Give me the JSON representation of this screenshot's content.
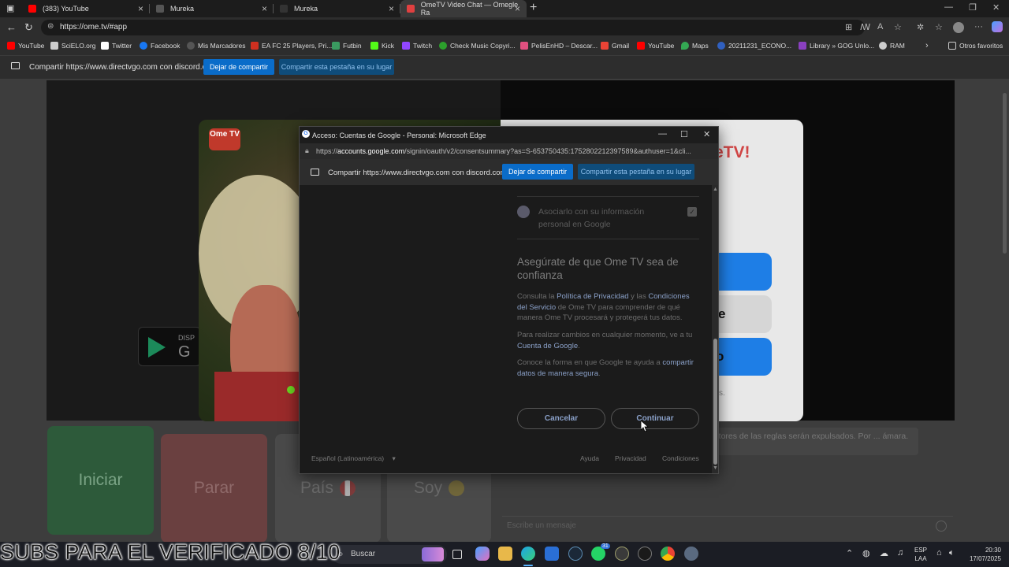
{
  "tabs": [
    {
      "title": "(383) YouTube",
      "favicon_color": "#ff0000"
    },
    {
      "title": "Mureka",
      "favicon_color": "#444444"
    },
    {
      "title": "Mureka",
      "favicon_color": "#222222"
    },
    {
      "title": "OmeTV Video Chat — Omegle Ra",
      "favicon_color": "#e04040"
    }
  ],
  "address": {
    "url": "https://ome.tv/#app"
  },
  "bookmarks": [
    {
      "label": "YouTube",
      "color": "#ff0000"
    },
    {
      "label": "SciELO.org",
      "color": "#cccccc"
    },
    {
      "label": "Twitter",
      "color": "#ffffff"
    },
    {
      "label": "Facebook",
      "color": "#1877f2"
    },
    {
      "label": "Mis Marcadores",
      "color": "#333333"
    },
    {
      "label": "EA FC 25 Players, Pri...",
      "color": "#d03020"
    },
    {
      "label": "Futbin",
      "color": "#3a9a60"
    },
    {
      "label": "Kick",
      "color": "#53fc18"
    },
    {
      "label": "Twitch",
      "color": "#9146ff"
    },
    {
      "label": "Check Music Copyri...",
      "color": "#2ca02c"
    },
    {
      "label": "PelisEnHD – Descar...",
      "color": "#e05080"
    },
    {
      "label": "Gmail",
      "color": "#ea4335"
    },
    {
      "label": "YouTube",
      "color": "#ff0000"
    },
    {
      "label": "Maps",
      "color": "#34a853"
    },
    {
      "label": "20211231_ECONO...",
      "color": "#3060c0"
    },
    {
      "label": "Library » GOG Unlo...",
      "color": "#8a40c0"
    },
    {
      "label": "RAM",
      "color": "#cccccc"
    }
  ],
  "other_favorites": "Otros favoritos",
  "share_bar": {
    "text": "Compartir https://www.directvgo.com con discord.com",
    "stop_label": "Dejar de compartir",
    "switch_label": "Compartir esta pestaña en su lugar"
  },
  "page": {
    "logo_text": "Ome TV",
    "gplay_small": "DISP",
    "gplay_big": "G",
    "login_title_fragment": "eTV!",
    "btn2_fragment": "e",
    "btn3_fragment": "o",
    "small_fragment": "s.",
    "controls": {
      "start": "Iniciar",
      "stop": "Parar",
      "country": "País",
      "gender": "Soy"
    },
    "chat_notice": "infractores de las reglas serán expulsados. Por ... ámara.",
    "chat_placeholder": "Escribe un mensaje"
  },
  "popup": {
    "title": "Acceso: Cuentas de Google - Personal: Microsoft Edge",
    "url_prefix": "https://",
    "url_host": "accounts.google.com",
    "url_rest": "/signin/oauth/v2/consentsummary?as=S-653750435:1752802212397589&authuser=1&cli...",
    "share_text": "Compartir https://www.directvgo.com con discord.com",
    "share_stop": "Dejar de compartir",
    "share_switch": "Compartir esta pestaña en su lugar",
    "item_text": "Asociarlo con su información personal en Google",
    "heading": "Asegúrate de que Ome TV sea de confianza",
    "p1_a": "Consulta la ",
    "p1_link1": "Política de Privacidad",
    "p1_b": " y las ",
    "p1_link2": "Condiciones del Servicio",
    "p1_c": " de Ome TV para comprender de qué manera Ome TV procesará y protegerá tus datos.",
    "p2_a": "Para realizar cambios en cualquier momento, ve a tu ",
    "p2_link": "Cuenta de Google",
    "p2_b": ".",
    "p3_a": "Conoce la forma en que Google te ayuda a ",
    "p3_link": "compartir datos de manera segura",
    "p3_b": ".",
    "cancel": "Cancelar",
    "continue": "Continuar",
    "language": "Español (Latinoamérica)",
    "footer": [
      "Ayuda",
      "Privacidad",
      "Condiciones"
    ]
  },
  "overlay_caption": "SUBS PARA EL VERIFICADO 8/10",
  "taskbar": {
    "search_label": "Buscar",
    "badges": {
      "whatsapp": "31"
    },
    "lang_line1": "ESP",
    "lang_line2": "LAA",
    "time": "20:30",
    "date": "17/07/2025"
  }
}
